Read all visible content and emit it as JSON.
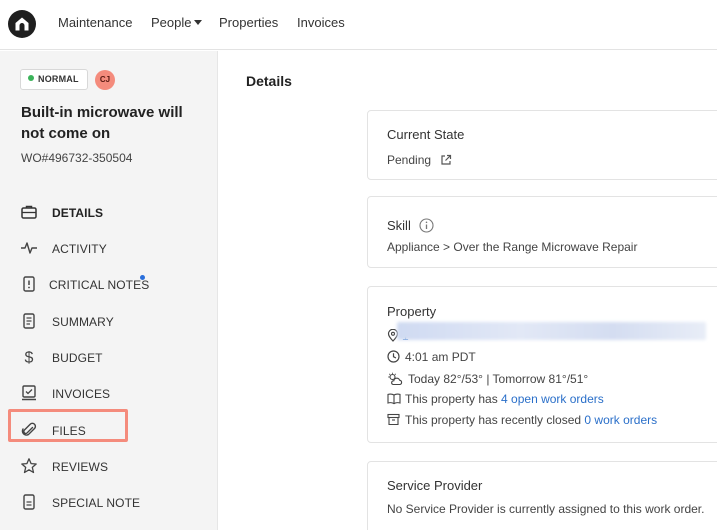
{
  "nav": {
    "items": [
      "Maintenance",
      "People",
      "Properties",
      "Invoices"
    ]
  },
  "sidebar": {
    "priority": "NORMAL",
    "assignee_initials": "CJ",
    "title": "Built-in microwave will not come on",
    "wo_number": "WO#496732-350504",
    "items": [
      {
        "label": "DETAILS",
        "icon": "briefcase-icon"
      },
      {
        "label": "ACTIVITY",
        "icon": "activity-icon"
      },
      {
        "label": "CRITICAL NOTES",
        "icon": "alert-note-icon"
      },
      {
        "label": "SUMMARY",
        "icon": "document-icon"
      },
      {
        "label": "BUDGET",
        "icon": "dollar-icon"
      },
      {
        "label": "INVOICES",
        "icon": "invoice-icon"
      },
      {
        "label": "FILES",
        "icon": "paperclip-icon"
      },
      {
        "label": "REVIEWS",
        "icon": "star-icon"
      },
      {
        "label": "SPECIAL NOTE",
        "icon": "note-icon"
      }
    ]
  },
  "main": {
    "title": "Details",
    "current_state": {
      "heading": "Current State",
      "value": "Pending"
    },
    "skill": {
      "heading": "Skill",
      "value": "Appliance > Over the Range Microwave Repair"
    },
    "property": {
      "heading": "Property",
      "address_prefix": "1",
      "time": "4:01 am PDT",
      "weather": "Today 82°/53° | Tomorrow 81°/51°",
      "open_prefix": "This property has ",
      "open_link": "4 open work orders",
      "closed_prefix": "This property has recently closed ",
      "closed_link": "0 work orders"
    },
    "service_provider": {
      "heading": "Service Provider",
      "value": "No Service Provider is currently assigned to this work order."
    }
  },
  "colors": {
    "accent_link": "#2a6fc9",
    "priority_dot": "#3bb35a",
    "avatar": "#f48b7c",
    "highlight": "#f48b7c"
  }
}
